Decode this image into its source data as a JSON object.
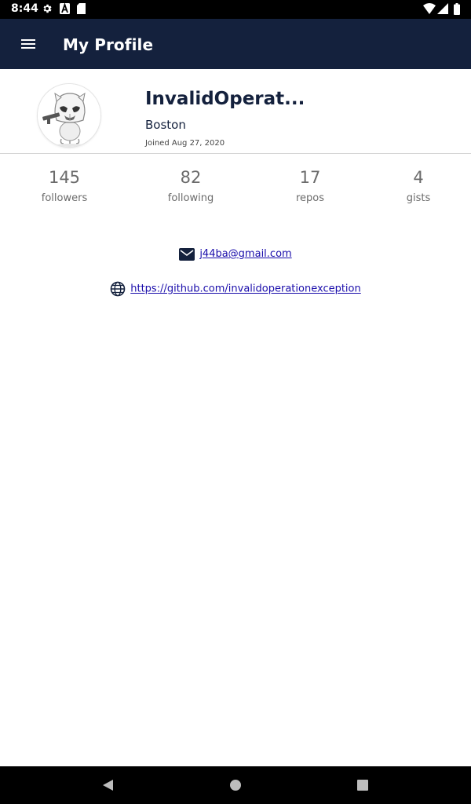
{
  "status_bar": {
    "time": "8:44",
    "icons": [
      "settings-icon",
      "a-badge-icon",
      "sd-card-icon",
      "wifi-icon",
      "signal-icon",
      "battery-icon"
    ]
  },
  "app_bar": {
    "title": "My Profile",
    "menu_icon": "hamburger-menu-icon",
    "background": "#14213d"
  },
  "profile": {
    "avatar": "stormtroopocat-avatar",
    "username": "InvalidOperat...",
    "location": "Boston",
    "joined": "Joined Aug 27, 2020"
  },
  "stats": [
    {
      "value": "145",
      "label": "followers"
    },
    {
      "value": "82",
      "label": "following"
    },
    {
      "value": "17",
      "label": "repos"
    },
    {
      "value": "4",
      "label": "gists"
    }
  ],
  "contact": {
    "email": "j44ba@gmail.com",
    "website": "https://github.com/invalidoperationexception",
    "email_icon": "mail-icon",
    "website_icon": "globe-icon"
  },
  "nav_bar": {
    "buttons": [
      "back-icon",
      "home-icon",
      "recents-icon"
    ]
  },
  "colors": {
    "accent": "#14213d",
    "link": "#1a0dab",
    "stat_text": "#6b6b6b"
  }
}
